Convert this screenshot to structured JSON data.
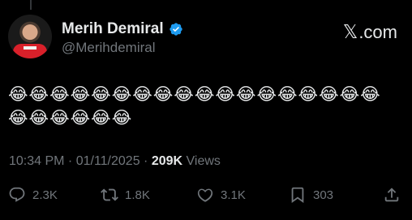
{
  "author": {
    "display_name": "Merih Demiral",
    "handle": "@Merihdemiral",
    "verified": true
  },
  "brand": {
    "x_glyph": "𝕏",
    "site_text": ".com"
  },
  "tweet": {
    "emoji_text": "😂😂😂😂😂😂😂😂😂😂😂😂😂😂😂😂😂😂😂😂😂😂😂😂"
  },
  "meta": {
    "time": "10:34 PM",
    "separator": " · ",
    "date": "01/11/2025",
    "views_count": "209K",
    "views_label": " Views"
  },
  "actions": {
    "replies": "2.3K",
    "reposts": "1.8K",
    "likes": "3.1K",
    "bookmarks": "303"
  },
  "icons": {
    "reply": "reply-icon",
    "repost": "repost-icon",
    "like": "like-icon",
    "bookmark": "bookmark-icon",
    "share": "share-icon",
    "verified": "verified-badge-icon"
  },
  "colors": {
    "background": "#000000",
    "text_primary": "#e7e9ea",
    "text_secondary": "#71767b",
    "verified_blue": "#1d9bf0"
  }
}
